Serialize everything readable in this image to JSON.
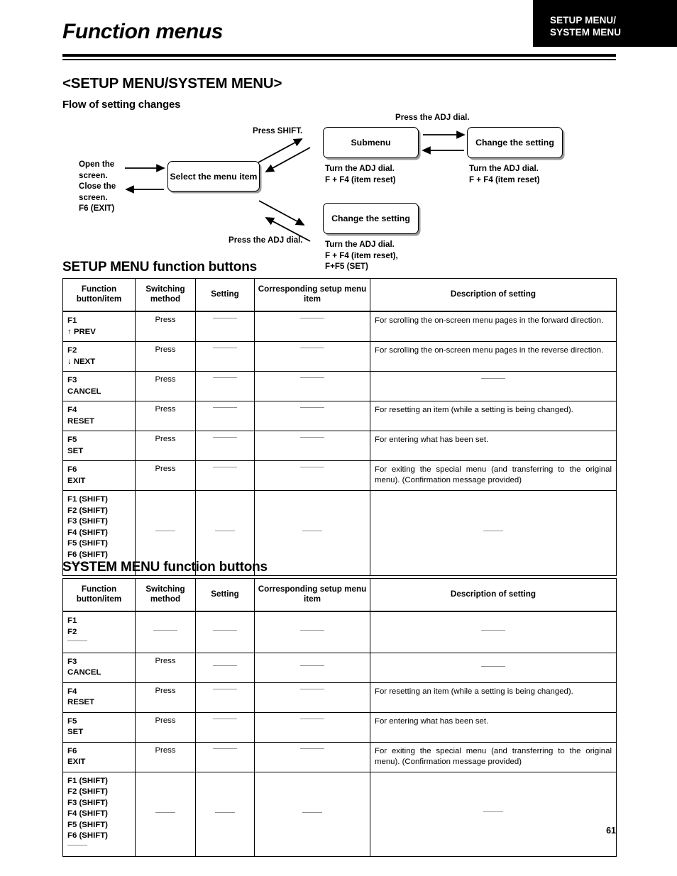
{
  "header": {
    "title": "Function menus",
    "corner_tab_line1": "SETUP MENU/",
    "corner_tab_line2": "SYSTEM MENU"
  },
  "headings": {
    "section": "<SETUP MENU/SYSTEM MENU>",
    "flow": "Flow of setting changes",
    "setup_buttons_bold": "SETUP MENU",
    "setup_buttons_rest": " function buttons",
    "system_buttons_bold": "SYSTEM MENU",
    "system_buttons_rest": " function buttons"
  },
  "flow": {
    "open_screen": "Open the\nscreen.",
    "close_screen": "Close the\nscreen.\nF6 (EXIT)",
    "select_menu_item": "Select the menu\nitem",
    "press_shift": "Press SHIFT.",
    "press_adj_dial_lower": "Press the ADJ dial.",
    "press_adj_dial_top": "Press the ADJ dial.",
    "submenu": "Submenu",
    "change_setting_top": "Change the setting",
    "change_setting_lower": "Change the setting",
    "note_submenu": "Turn the ADJ dial.\nF + F4 (item reset)",
    "note_change_top": "Turn the ADJ dial.\nF + F4 (item reset)",
    "note_change_lower": "Turn the ADJ dial.\nF + F4 (item reset),\nF+F5 (SET)"
  },
  "table_columns": [
    "Function\nbutton/item",
    "Switching\nmethod",
    "Setting",
    "Corresponding setup\nmenu item",
    "Description of setting"
  ],
  "setup_table_rows": [
    {
      "button": "F1\n↑ PREV",
      "switching": "Press",
      "setting": "—",
      "corresponding": "—",
      "description": "For scrolling the on-screen menu pages in the forward direction."
    },
    {
      "button": "F2\n↓ NEXT",
      "switching": "Press",
      "setting": "—",
      "corresponding": "—",
      "description": "For scrolling the on-screen menu pages in the reverse direction."
    },
    {
      "button": "F3\nCANCEL",
      "switching": "Press",
      "setting": "—",
      "corresponding": "—",
      "description": "—"
    },
    {
      "button": "F4\nRESET",
      "switching": "Press",
      "setting": "—",
      "corresponding": "—",
      "description": "For resetting an item (while a setting is being changed)."
    },
    {
      "button": "F5\nSET",
      "switching": "Press",
      "setting": "—",
      "corresponding": "—",
      "description": "For entering what has been set."
    },
    {
      "button": "F6\nEXIT",
      "switching": "Press",
      "setting": "—",
      "corresponding": "—",
      "description": "For exiting the special menu (and transferring to the original menu).  (Confirmation message provided)"
    },
    {
      "button": "F1 (SHIFT)\nF2 (SHIFT)\nF3 (SHIFT)\nF4 (SHIFT)\nF5 (SHIFT)\nF6 (SHIFT)",
      "button_dash": "—",
      "switching": "—",
      "setting": "—",
      "corresponding": "—",
      "description": "—"
    }
  ],
  "system_table_rows": [
    {
      "button": "F1\nF2",
      "button_dash": "—",
      "switching": "—",
      "setting": "—",
      "corresponding": "—",
      "description": "—"
    },
    {
      "button": "F3\nCANCEL",
      "switching": "Press",
      "setting": "—",
      "corresponding": "—",
      "description": "—"
    },
    {
      "button": "F4\nRESET",
      "switching": "Press",
      "setting": "—",
      "corresponding": "—",
      "description": "For resetting an item (while a setting is being changed)."
    },
    {
      "button": "F5\nSET",
      "switching": "Press",
      "setting": "—",
      "corresponding": "—",
      "description": "For entering what has been set."
    },
    {
      "button": "F6\nEXIT",
      "switching": "Press",
      "setting": "—",
      "corresponding": "—",
      "description": "For exiting the special menu (and transferring to the original menu).  (Confirmation message provided)"
    },
    {
      "button": "F1 (SHIFT)\nF2 (SHIFT)\nF3 (SHIFT)\nF4 (SHIFT)\nF5 (SHIFT)\nF6 (SHIFT)",
      "button_dash": "—",
      "switching": "—",
      "setting": "—",
      "corresponding": "—",
      "description": "—"
    }
  ],
  "footer": {
    "page_number": "61"
  },
  "colors": {
    "tab_background": "#000000",
    "tab_text": "#ffffff",
    "text": "#000000",
    "dash": "#8f8f8f",
    "box_shadow": "#9a9a9a"
  }
}
